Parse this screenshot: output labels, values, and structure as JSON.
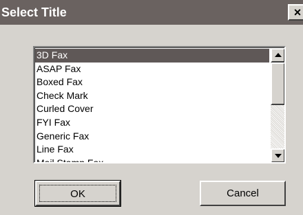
{
  "dialog": {
    "title": "Select Title",
    "close_label": "×"
  },
  "list": {
    "selected_index": 0,
    "items": [
      "3D Fax",
      "ASAP Fax",
      "Boxed Fax",
      "Check Mark",
      "Curled Cover",
      "FYI Fax",
      "Generic Fax",
      "Line Fax",
      "Mail Stamp Fax"
    ]
  },
  "buttons": {
    "ok": "OK",
    "cancel": "Cancel"
  },
  "colors": {
    "titlebar": "#6a6260",
    "selection": "#5f5857",
    "face": "#d6d3ce"
  }
}
